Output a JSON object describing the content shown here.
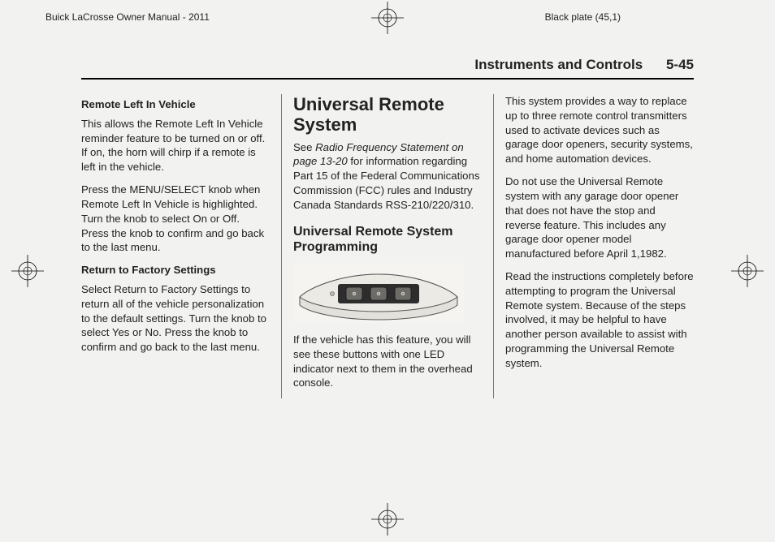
{
  "top": {
    "left": "Buick LaCrosse Owner Manual - 2011",
    "right": "Black plate (45,1)"
  },
  "header": {
    "section": "Instruments and Controls",
    "page": "5-45"
  },
  "col1": {
    "h1": "Remote Left In Vehicle",
    "p1": "This allows the Remote Left In Vehicle reminder feature to be turned on or off. If on, the horn will chirp if a remote is left in the vehicle.",
    "p2": "Press the MENU/SELECT knob when Remote Left In Vehicle is highlighted. Turn the knob to select On or Off. Press the knob to confirm and go back to the last menu.",
    "h2": "Return to Factory Settings",
    "p3": "Select Return to Factory Settings to return all of the vehicle personalization to the default settings. Turn the knob to select Yes or No. Press the knob to confirm and go back to the last menu."
  },
  "col2": {
    "title": "Universal Remote System",
    "see_pre": "See ",
    "see_ital": "Radio Frequency Statement on page 13‑20",
    "see_post": " for information regarding Part 15 of the Federal Communications Commission (FCC) rules and Industry Canada Standards RSS-210/220/310.",
    "sub": "Universal Remote System Programming",
    "p_post_img": "If the vehicle has this feature, you will see these buttons with one LED indicator next to them in the overhead console."
  },
  "col3": {
    "p1": "This system provides a way to replace up to three remote control transmitters used to activate devices such as garage door openers, security systems, and home automation devices.",
    "p2": "Do not use the Universal Remote system with any garage door opener that does not have the stop and reverse feature. This includes any garage door opener model manufactured before April 1,1982.",
    "p3": "Read the instructions completely before attempting to program the Universal Remote system. Because of the steps involved, it may be helpful to have another person available to assist with programming the Universal Remote system."
  }
}
